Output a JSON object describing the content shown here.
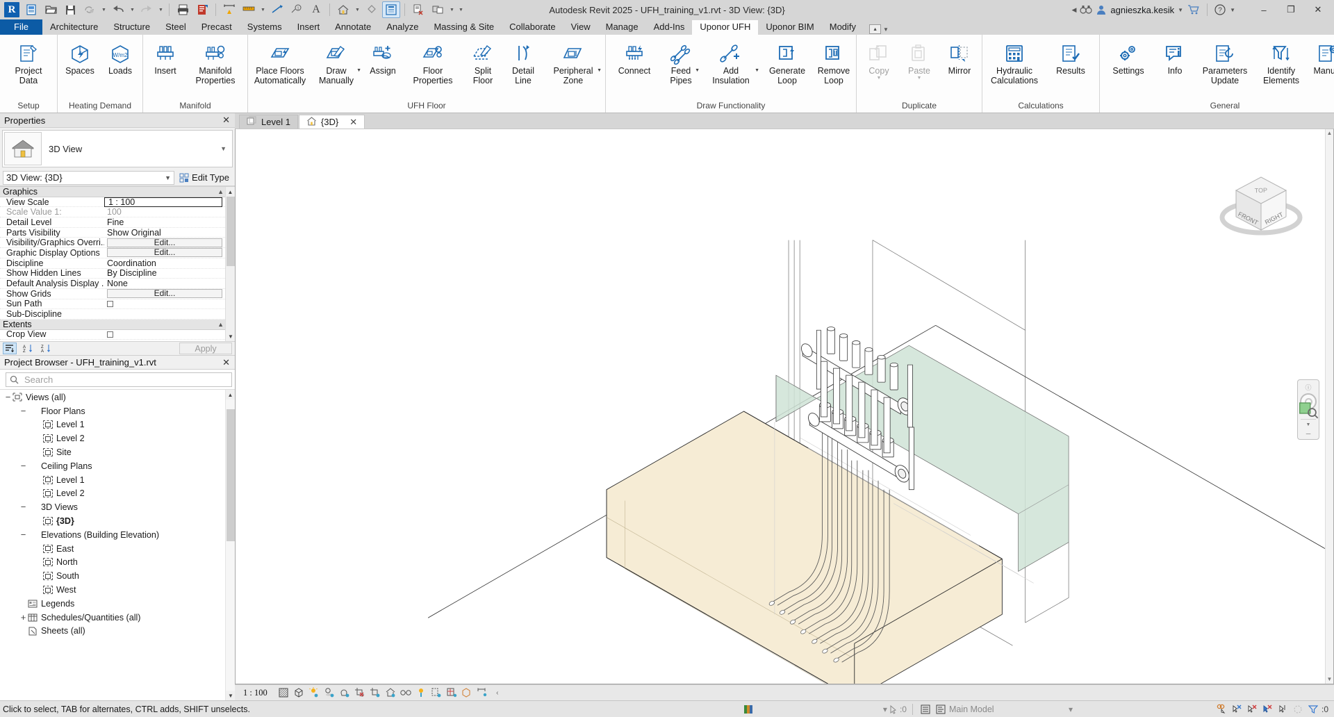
{
  "titlebar": {
    "app_title": "Autodesk Revit 2025 - UFH_training_v1.rvt - 3D View: {3D}",
    "account": "agnieszka.kesik",
    "qat": [
      {
        "name": "revit-logo",
        "glyph": "R"
      },
      {
        "name": "new-project-icon",
        "glyph": "new"
      },
      {
        "name": "open-icon",
        "glyph": "open"
      },
      {
        "name": "save-icon",
        "glyph": "save"
      },
      {
        "name": "sync-icon",
        "glyph": "sync"
      },
      {
        "name": "undo-icon",
        "glyph": "undo"
      },
      {
        "name": "redo-icon",
        "glyph": "redo"
      },
      {
        "name": "print-icon",
        "glyph": "print"
      },
      {
        "name": "measure-icon",
        "glyph": "measure"
      },
      {
        "name": "aligned-dimension-icon",
        "glyph": "aligned-dim"
      },
      {
        "name": "tag-icon",
        "glyph": "tag"
      },
      {
        "name": "text-icon",
        "glyph": "A"
      },
      {
        "name": "default-3d-view-icon",
        "glyph": "home"
      },
      {
        "name": "section-icon",
        "glyph": "section"
      },
      {
        "name": "thin-lines-icon",
        "glyph": "thinlines"
      },
      {
        "name": "close-hidden-windows-icon",
        "glyph": "closehidden"
      },
      {
        "name": "switch-windows-icon",
        "glyph": "switchwin"
      }
    ],
    "window_buttons": {
      "minimize": "–",
      "restore": "❐",
      "close": "✕"
    }
  },
  "tabs": {
    "file_label": "File",
    "items": [
      {
        "label": "Architecture",
        "active": false
      },
      {
        "label": "Structure",
        "active": false
      },
      {
        "label": "Steel",
        "active": false
      },
      {
        "label": "Precast",
        "active": false
      },
      {
        "label": "Systems",
        "active": false
      },
      {
        "label": "Insert",
        "active": false
      },
      {
        "label": "Annotate",
        "active": false
      },
      {
        "label": "Analyze",
        "active": false
      },
      {
        "label": "Massing & Site",
        "active": false
      },
      {
        "label": "Collaborate",
        "active": false
      },
      {
        "label": "View",
        "active": false
      },
      {
        "label": "Manage",
        "active": false
      },
      {
        "label": "Add-Ins",
        "active": false
      },
      {
        "label": "Uponor UFH",
        "active": true
      },
      {
        "label": "Uponor BIM",
        "active": false
      },
      {
        "label": "Modify",
        "active": false
      }
    ]
  },
  "ribbon": {
    "panels": [
      {
        "title": "Setup",
        "buttons": [
          {
            "label": "Project\nData",
            "icon": "project-data-icon",
            "dropdown": false,
            "disabled": false
          }
        ]
      },
      {
        "title": "Heating Demand",
        "buttons": [
          {
            "label": "Spaces",
            "icon": "spaces-icon",
            "dropdown": false,
            "disabled": false
          },
          {
            "label": "Loads",
            "icon": "loads-icon",
            "dropdown": false,
            "disabled": false
          }
        ]
      },
      {
        "title": "Manifold",
        "buttons": [
          {
            "label": "Insert",
            "icon": "insert-manifold-icon",
            "dropdown": false,
            "disabled": false
          },
          {
            "label": "Manifold\nProperties",
            "icon": "manifold-properties-icon",
            "dropdown": false,
            "disabled": false
          }
        ]
      },
      {
        "title": "UFH Floor",
        "buttons": [
          {
            "label": "Place Floors\nAutomatically",
            "icon": "place-floors-automatically-icon",
            "dropdown": false,
            "disabled": false
          },
          {
            "label": "Draw\nManually",
            "icon": "draw-manually-icon",
            "dropdown": true,
            "disabled": false
          },
          {
            "label": "Assign",
            "icon": "assign-icon",
            "dropdown": false,
            "disabled": false
          },
          {
            "label": "Floor\nProperties",
            "icon": "floor-properties-icon",
            "dropdown": false,
            "disabled": false
          },
          {
            "label": "Split\nFloor",
            "icon": "split-floor-icon",
            "dropdown": false,
            "disabled": false
          },
          {
            "label": "Detail\nLine",
            "icon": "detail-line-icon",
            "dropdown": false,
            "disabled": false
          },
          {
            "label": "Peripheral\nZone",
            "icon": "peripheral-zone-icon",
            "dropdown": true,
            "disabled": false
          }
        ]
      },
      {
        "title": "Draw Functionality",
        "buttons": [
          {
            "label": "Connect",
            "icon": "connect-icon",
            "dropdown": false,
            "disabled": false
          },
          {
            "label": "Feed\nPipes",
            "icon": "feed-pipes-icon",
            "dropdown": true,
            "disabled": false
          },
          {
            "label": "Add\nInsulation",
            "icon": "add-insulation-icon",
            "dropdown": true,
            "disabled": false
          },
          {
            "label": "Generate\nLoop",
            "icon": "generate-loop-icon",
            "dropdown": false,
            "disabled": false
          },
          {
            "label": "Remove\nLoop",
            "icon": "remove-loop-icon",
            "dropdown": false,
            "disabled": false
          }
        ]
      },
      {
        "title": "Duplicate",
        "buttons": [
          {
            "label": "Copy",
            "icon": "copy-icon",
            "dropdown": true,
            "disabled": true
          },
          {
            "label": "Paste",
            "icon": "paste-icon",
            "dropdown": true,
            "disabled": true
          },
          {
            "label": "Mirror",
            "icon": "mirror-icon",
            "dropdown": false,
            "disabled": false
          }
        ]
      },
      {
        "title": "Calculations",
        "buttons": [
          {
            "label": "Hydraulic\nCalculations",
            "icon": "hydraulic-calculations-icon",
            "dropdown": false,
            "disabled": false
          },
          {
            "label": "Results",
            "icon": "results-icon",
            "dropdown": false,
            "disabled": false
          }
        ]
      },
      {
        "title": "General",
        "buttons": [
          {
            "label": "Settings",
            "icon": "settings-icon",
            "dropdown": false,
            "disabled": false
          },
          {
            "label": "Info",
            "icon": "info-icon",
            "dropdown": false,
            "disabled": false
          },
          {
            "label": "Parameters\nUpdate",
            "icon": "parameters-update-icon",
            "dropdown": false,
            "disabled": false
          },
          {
            "label": "Identify\nElements",
            "icon": "identify-elements-icon",
            "dropdown": false,
            "disabled": false
          },
          {
            "label": "Manual",
            "icon": "manual-icon",
            "dropdown": false,
            "disabled": false
          }
        ]
      }
    ]
  },
  "properties": {
    "header": "Properties",
    "type_label": "3D View",
    "selector_value": "3D View: {3D}",
    "edit_type_label": "Edit Type",
    "apply_label": "Apply",
    "groups": [
      {
        "name": "Graphics",
        "rows": [
          {
            "name": "View Scale",
            "value": "1 : 100",
            "kind": "boxed"
          },
          {
            "name": "Scale Value    1:",
            "value": "100",
            "kind": "dim"
          },
          {
            "name": "Detail Level",
            "value": "Fine",
            "kind": "text"
          },
          {
            "name": "Parts Visibility",
            "value": "Show Original",
            "kind": "text"
          },
          {
            "name": "Visibility/Graphics Overri...",
            "value": "Edit...",
            "kind": "button"
          },
          {
            "name": "Graphic Display Options",
            "value": "Edit...",
            "kind": "button"
          },
          {
            "name": "Discipline",
            "value": "Coordination",
            "kind": "text"
          },
          {
            "name": "Show Hidden Lines",
            "value": "By Discipline",
            "kind": "text"
          },
          {
            "name": "Default Analysis Display ...",
            "value": "None",
            "kind": "text"
          },
          {
            "name": "Show Grids",
            "value": "Edit...",
            "kind": "button"
          },
          {
            "name": "Sun Path",
            "value": "",
            "kind": "checkbox"
          },
          {
            "name": "Sub-Discipline",
            "value": "",
            "kind": "text"
          }
        ]
      },
      {
        "name": "Extents",
        "rows": [
          {
            "name": "Crop View",
            "value": "",
            "kind": "checkbox"
          }
        ]
      }
    ]
  },
  "project_browser": {
    "header": "Project Browser - UFH_training_v1.rvt",
    "search_placeholder": "Search",
    "search_value": "",
    "tree": [
      {
        "label": "Views (all)",
        "depth": 0,
        "expander": "−",
        "icon": "views-all-icon",
        "bold": false
      },
      {
        "label": "Floor Plans",
        "depth": 1,
        "expander": "−",
        "icon": "none",
        "bold": false
      },
      {
        "label": "Level 1",
        "depth": 2,
        "expander": "",
        "icon": "view-icon",
        "bold": false
      },
      {
        "label": "Level 2",
        "depth": 2,
        "expander": "",
        "icon": "view-icon",
        "bold": false
      },
      {
        "label": "Site",
        "depth": 2,
        "expander": "",
        "icon": "view-icon",
        "bold": false
      },
      {
        "label": "Ceiling Plans",
        "depth": 1,
        "expander": "−",
        "icon": "none",
        "bold": false
      },
      {
        "label": "Level 1",
        "depth": 2,
        "expander": "",
        "icon": "view-icon",
        "bold": false
      },
      {
        "label": "Level 2",
        "depth": 2,
        "expander": "",
        "icon": "view-icon",
        "bold": false
      },
      {
        "label": "3D Views",
        "depth": 1,
        "expander": "−",
        "icon": "none",
        "bold": false
      },
      {
        "label": "{3D}",
        "depth": 2,
        "expander": "",
        "icon": "view-icon",
        "bold": true
      },
      {
        "label": "Elevations (Building Elevation)",
        "depth": 1,
        "expander": "−",
        "icon": "none",
        "bold": false
      },
      {
        "label": "East",
        "depth": 2,
        "expander": "",
        "icon": "view-icon",
        "bold": false
      },
      {
        "label": "North",
        "depth": 2,
        "expander": "",
        "icon": "view-icon",
        "bold": false
      },
      {
        "label": "South",
        "depth": 2,
        "expander": "",
        "icon": "view-icon",
        "bold": false
      },
      {
        "label": "West",
        "depth": 2,
        "expander": "",
        "icon": "view-icon",
        "bold": false
      },
      {
        "label": "Legends",
        "depth": 1,
        "expander": "",
        "icon": "legends-icon",
        "bold": false
      },
      {
        "label": "Schedules/Quantities (all)",
        "depth": 1,
        "expander": "+",
        "icon": "schedules-icon",
        "bold": false
      },
      {
        "label": "Sheets (all)",
        "depth": 1,
        "expander": "",
        "icon": "sheets-icon",
        "bold": false
      }
    ]
  },
  "view_tabs": [
    {
      "label": "Level 1",
      "active": false,
      "closable": false
    },
    {
      "label": "{3D}",
      "active": true,
      "closable": true
    }
  ],
  "viewcube": {
    "top": "TOP",
    "front": "FRONT",
    "right": "RIGHT"
  },
  "viewbar": {
    "scale": "1 : 100",
    "icons": [
      "detail-level-icon",
      "visual-style-icon",
      "sun-path-icon",
      "shadows-icon",
      "rendering-dialog-icon",
      "crop-view-off-icon",
      "show-crop-region-icon",
      "lock-3d-view-icon",
      "temporary-hide-isolate-icon",
      "reveal-hidden-elements-icon",
      "temporary-view-properties-icon",
      "show-analytical-model-icon",
      "highlight-displacement-sets-icon",
      "constraints-icon"
    ]
  },
  "statusbar": {
    "hint": "Click to select, TAB for alternates, CTRL adds, SHIFT unselects.",
    "selection_count": ":0",
    "model_label": "Main Model",
    "filter_count": ":0",
    "right_icons": [
      "editable-only-icon",
      "select-links-icon",
      "select-underlay-icon",
      "select-pinned-icon",
      "select-face-icon",
      "drag-elements-icon",
      "filter-icon"
    ]
  },
  "colors": {
    "accent": "#0c5ba5",
    "icon_blue": "#1d6cb5",
    "floor_fill": "#f5ead0",
    "zone_fill": "#c8ded0",
    "ribbon_bg": "#fdfdfd",
    "chrome_bg": "#d6d6d6"
  },
  "canvas": {
    "description": "3D isometric view of underfloor heating manifold with loop pipes over a floor slab"
  }
}
